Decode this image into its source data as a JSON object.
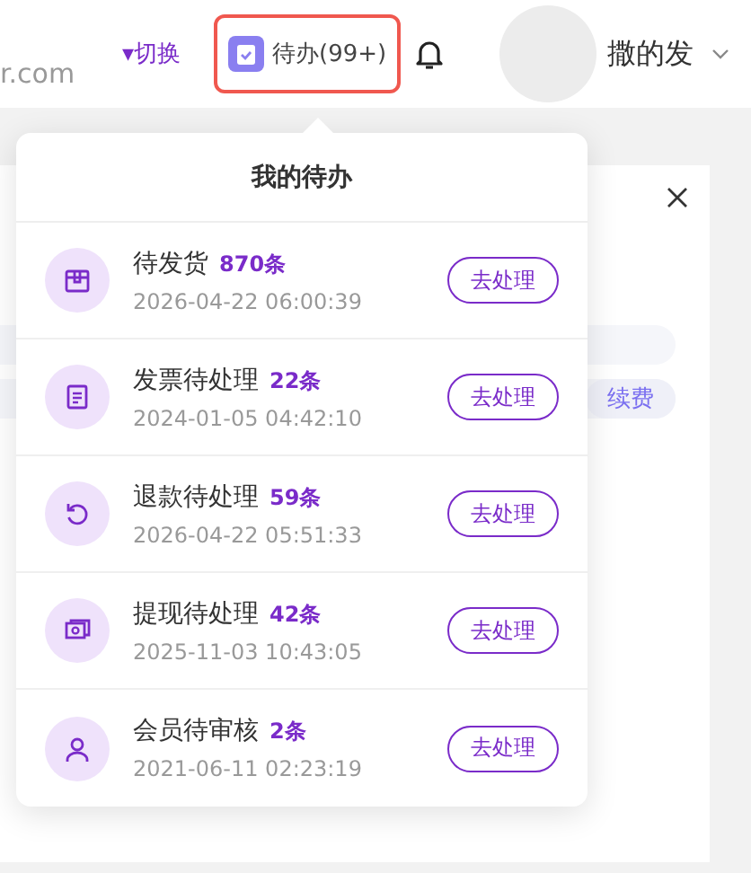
{
  "header": {
    "site": "r.com",
    "switch": "▾切换",
    "todo_button": {
      "label": "待办(99+)",
      "highlighted": true
    },
    "user": "撒的发"
  },
  "background": {
    "renew": "续费"
  },
  "todo_panel": {
    "title": "我的待办",
    "items": [
      {
        "kind": "shipping",
        "title": "待发货",
        "count": "870条",
        "time": "2026-04-22 06:00:39",
        "action": "去处理"
      },
      {
        "kind": "invoice",
        "title": "发票待处理",
        "count": "22条",
        "time": "2024-01-05 04:42:10",
        "action": "去处理"
      },
      {
        "kind": "refund",
        "title": "退款待处理",
        "count": "59条",
        "time": "2026-04-22 05:51:33",
        "action": "去处理"
      },
      {
        "kind": "withdraw",
        "title": "提现待处理",
        "count": "42条",
        "time": "2025-11-03 10:43:05",
        "action": "去处理"
      },
      {
        "kind": "member",
        "title": "会员待审核",
        "count": "2条",
        "time": "2021-06-11 02:23:19",
        "action": "去处理"
      }
    ]
  }
}
